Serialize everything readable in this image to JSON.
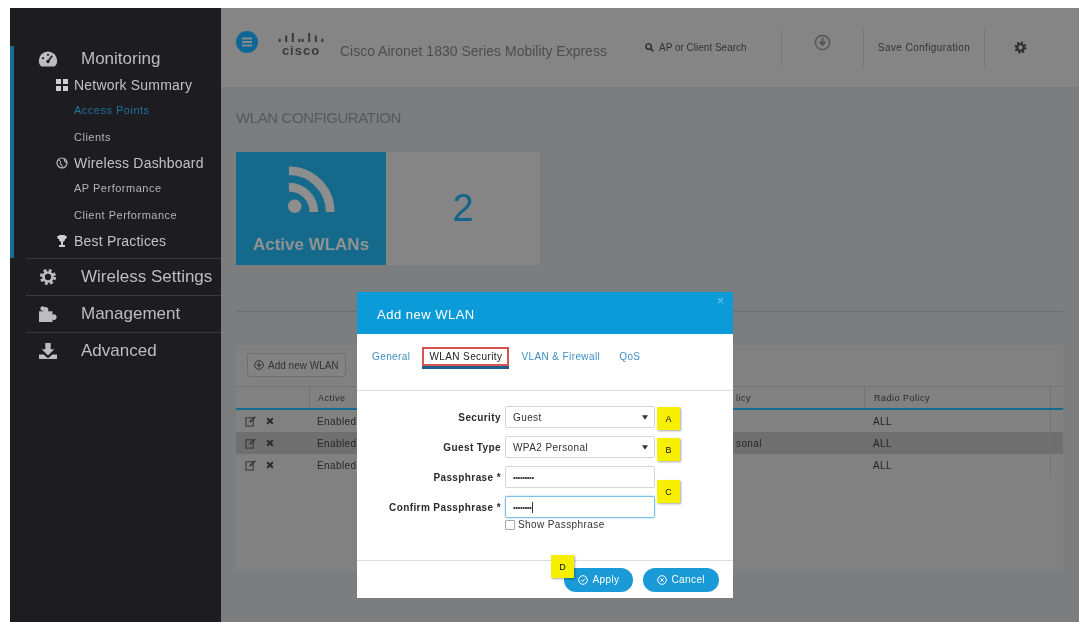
{
  "sidebar": {
    "items": [
      {
        "label": "Monitoring",
        "expanded": true,
        "selected": false,
        "children": [
          {
            "label": "Network Summary",
            "selected": false,
            "children": [
              {
                "label": "Access Points",
                "selected": true
              },
              {
                "label": "Clients",
                "selected": false
              }
            ]
          },
          {
            "label": "Wireless Dashboard",
            "selected": false,
            "children": [
              {
                "label": "AP Performance",
                "selected": false
              },
              {
                "label": "Client Performance",
                "selected": false
              }
            ]
          },
          {
            "label": "Best Practices",
            "selected": false
          }
        ]
      },
      {
        "label": "Wireless Settings",
        "expanded": false,
        "selected": false
      },
      {
        "label": "Management",
        "expanded": false,
        "selected": false
      },
      {
        "label": "Advanced",
        "expanded": false,
        "selected": false
      }
    ]
  },
  "header": {
    "logo": "cisco",
    "title": "Cisco Aironet 1830 Series Mobility Express",
    "search": {
      "placeholder": "AP or Client Search"
    },
    "save_button": "Save Configuration"
  },
  "page_title": "WLAN CONFIGURATION",
  "tile": {
    "label": "Active WLANs",
    "count": "2"
  },
  "table": {
    "add_button": "Add new WLAN",
    "columns": [
      {
        "label": "Active"
      },
      {
        "label": "licy"
      },
      {
        "label": "Radio Policy"
      }
    ],
    "rows": [
      {
        "active": "Enabled",
        "column_3": null,
        "radio_policy": "ALL",
        "selected": false
      },
      {
        "active": "Enabled",
        "column_3": "sonal",
        "radio_policy": "ALL",
        "selected": true
      },
      {
        "active": "Enabled",
        "column_3": null,
        "radio_policy": "ALL",
        "selected": false
      }
    ]
  },
  "dialog": {
    "title": "Add new WLAN",
    "close": "×",
    "tabs": [
      {
        "label": "General",
        "selected": false
      },
      {
        "label": "WLAN Security",
        "selected": true
      },
      {
        "label": "VLAN & Firewall",
        "selected": false
      },
      {
        "label": "QoS",
        "selected": false
      }
    ],
    "fields": [
      {
        "label": "Security",
        "kind": "select",
        "value": "Guest",
        "focused": false
      },
      {
        "label": "Guest Type",
        "kind": "select",
        "value": "WPA2 Personal",
        "focused": false
      },
      {
        "label": "Passphrase *",
        "kind": "password",
        "value": "•••••••••",
        "focused": false
      },
      {
        "label": "Confirm Passphrase *",
        "kind": "password",
        "value": "••••••••",
        "focused": true
      }
    ],
    "show_passphrase": {
      "label": "Show Passphrase",
      "checked": false
    },
    "buttons": [
      {
        "label": "Apply",
        "kind": "apply"
      },
      {
        "label": "Cancel",
        "kind": "cancel"
      }
    ]
  },
  "markers": [
    {
      "label": "A"
    },
    {
      "label": "B"
    },
    {
      "label": "C"
    },
    {
      "label": "D"
    }
  ]
}
